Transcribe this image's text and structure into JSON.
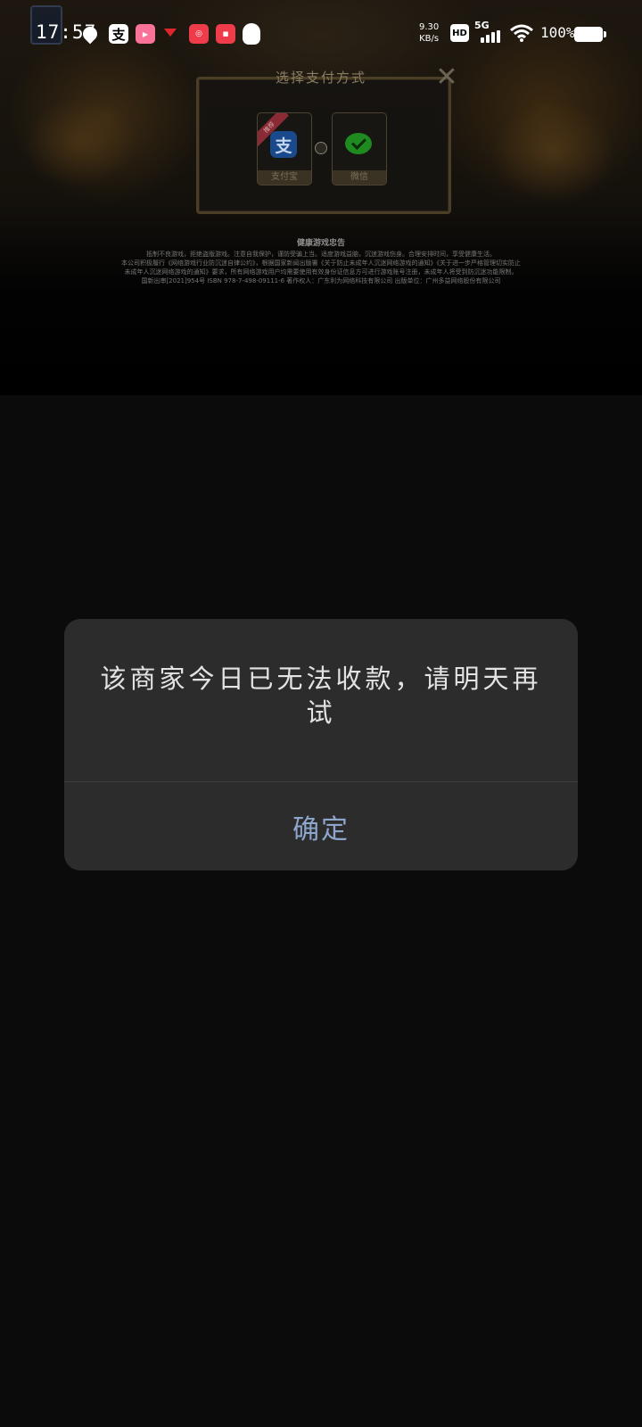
{
  "status_bar": {
    "time": "17:57",
    "net_speed_value": "9.30",
    "net_speed_unit": "KB/s",
    "hd_label": "HD",
    "network_label": "5G",
    "battery_text": "100%",
    "icons": [
      "map-pin-icon",
      "alipay-icon",
      "bilibili-icon",
      "diamond-icon",
      "app-icon",
      "app-icon",
      "qq-penguin-icon",
      "signal-icon",
      "wifi-icon",
      "battery-icon"
    ]
  },
  "payment": {
    "title": "选择支付方式",
    "close_symbol": "✕",
    "options": [
      {
        "label": "支付宝",
        "badge": "推荐",
        "logo_char": "支",
        "color": "#1a4a8c"
      },
      {
        "label": "微信",
        "color": "#1f8a1f"
      }
    ]
  },
  "notice": {
    "title": "健康游戏忠告",
    "lines": [
      "抵制不良游戏，拒绝盗版游戏。注意自我保护，谨防受骗上当。适度游戏益脑，沉迷游戏伤身。合理安排时间，享受健康生活。",
      "本公司积极履行《网络游戏行业防沉迷自律公约》，根据国家新闻出版署《关于防止未成年人沉迷网络游戏的通知》《关于进一步严格管理切实防止",
      "未成年人沉迷网络游戏的通知》要求，所有网络游戏用户均需要使用有效身份证信息方可进行游戏账号注册，未成年人将受到防沉迷功能限制。",
      "国新出审[2021]954号   ISBN 978-7-498-09111-6   著作权人：广东利为网络科技有限公司   出版单位：广州多益网络股份有限公司"
    ]
  },
  "dialog": {
    "message": "该商家今日已无法收款，请明天再试",
    "confirm_label": "确定",
    "accent_color": "#8ea6cc"
  }
}
